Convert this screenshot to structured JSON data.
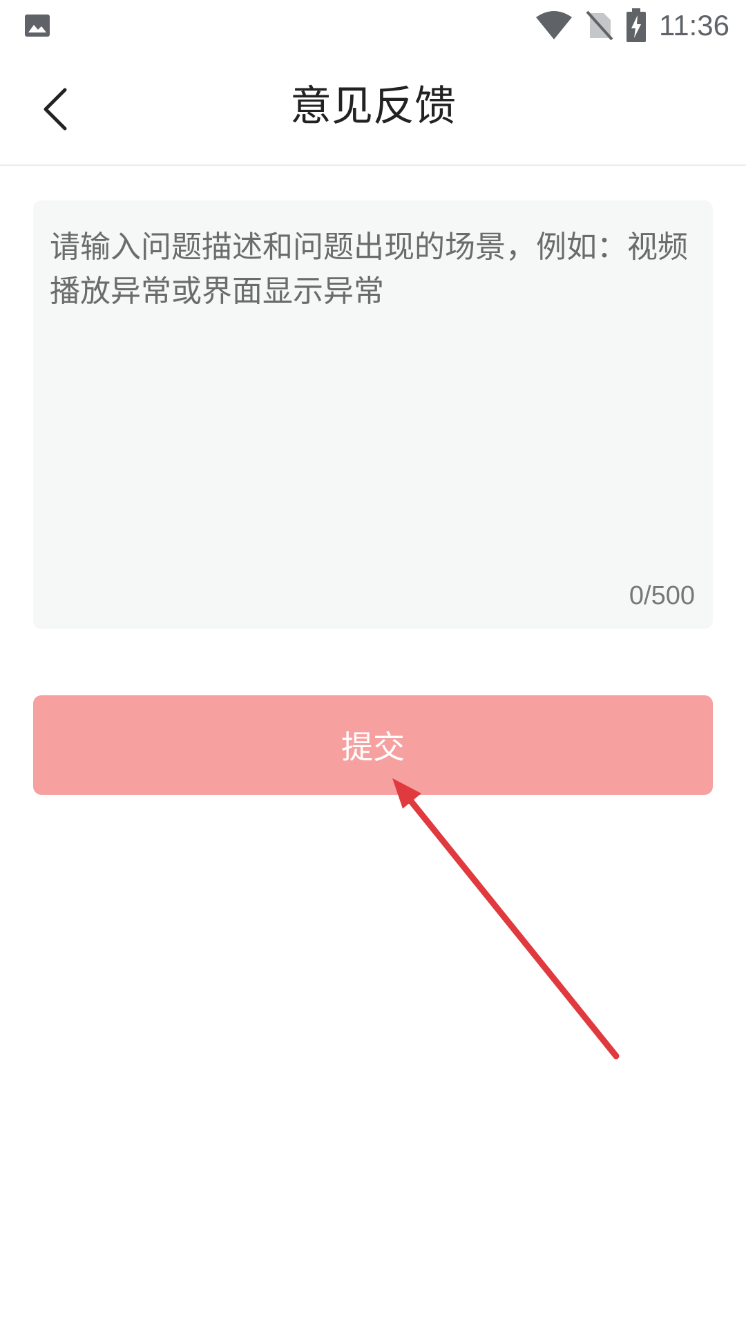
{
  "status_bar": {
    "time": "11:36",
    "left_icon": "image-notification-icon",
    "right_icons": [
      "wifi-icon",
      "no-sim-icon",
      "battery-charging-icon"
    ]
  },
  "header": {
    "back_icon": "chevron-left-icon",
    "title": "意见反馈"
  },
  "feedback": {
    "value": "",
    "placeholder": "请输入问题描述和问题出现的场景，例如：视频播放异常或界面显示异常",
    "counter": "0/500"
  },
  "submit": {
    "label": "提交"
  },
  "colors": {
    "submit_bg": "#f6a1a0",
    "input_bg": "#f6f7f7",
    "annotation": "#e0393e"
  }
}
